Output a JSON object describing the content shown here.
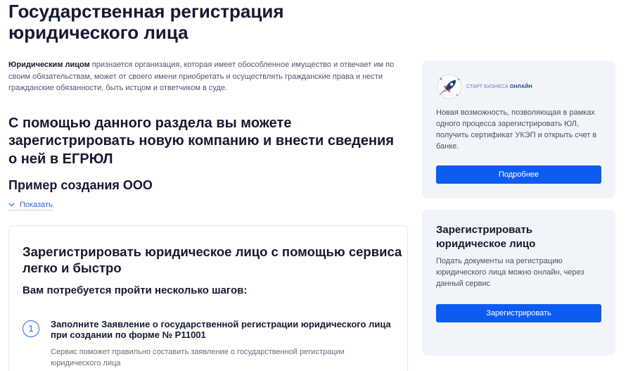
{
  "page": {
    "title": "Государственная регистрация юридического лица"
  },
  "intro": {
    "term": "Юридическим лицом",
    "definition": "признается организация, которая имеет обособленное имущество и отвечает им по своим обязательствам, может от своего имени приобретать и осуществлять гражданские права и нести гражданские обязанности, быть истцом и ответчиком в суде."
  },
  "section": {
    "heading_lines": [
      "С помощью данного раздела вы можете",
      "зарегистрировать новую компанию и внести сведения",
      "о ней в ЕГРЮЛ"
    ],
    "example_title": "Пример создания ООО",
    "show_link": {
      "icon": "chevron-down-icon",
      "label": "Показать"
    }
  },
  "steps_card": {
    "heading_lines": [
      "Зарегистрировать юридическое лицо с помощью сервиса",
      "легко и быстро"
    ],
    "subheading": "Вам потребуется пройти несколько шагов:",
    "steps": [
      {
        "number": "1",
        "title_lines": [
          "Заполните Заявление о государственной регистрации юридического лица",
          "при создании по форме № Р11001"
        ],
        "description": "Сервис поможет правильно составить заявление о государственной регистрации юридического лица"
      }
    ]
  },
  "sidebar": {
    "promo": {
      "logo": {
        "icon": "rocket-icon",
        "text_light": "СТАРТ БИЗНЕСА",
        "text_bold": "ОНЛАЙН"
      },
      "text": "Новая возможность, позволяющая в рамках одного процесса зарегистрировать ЮЛ, получить сертификат УКЭП и открыть счет в банке.",
      "button_label": "Подробнее"
    },
    "register": {
      "heading": "Зарегистрировать юридическое лицо",
      "text": "Подать документы на регистрацию юридического лица можно онлайн, через данный сервис",
      "button_label": "Зарегистрировать"
    }
  },
  "colors": {
    "accent": "#0d5cf2",
    "heading_text": "#141a31",
    "body_text": "#50566a",
    "sidebar_card_bg": "#f1f4f9"
  }
}
